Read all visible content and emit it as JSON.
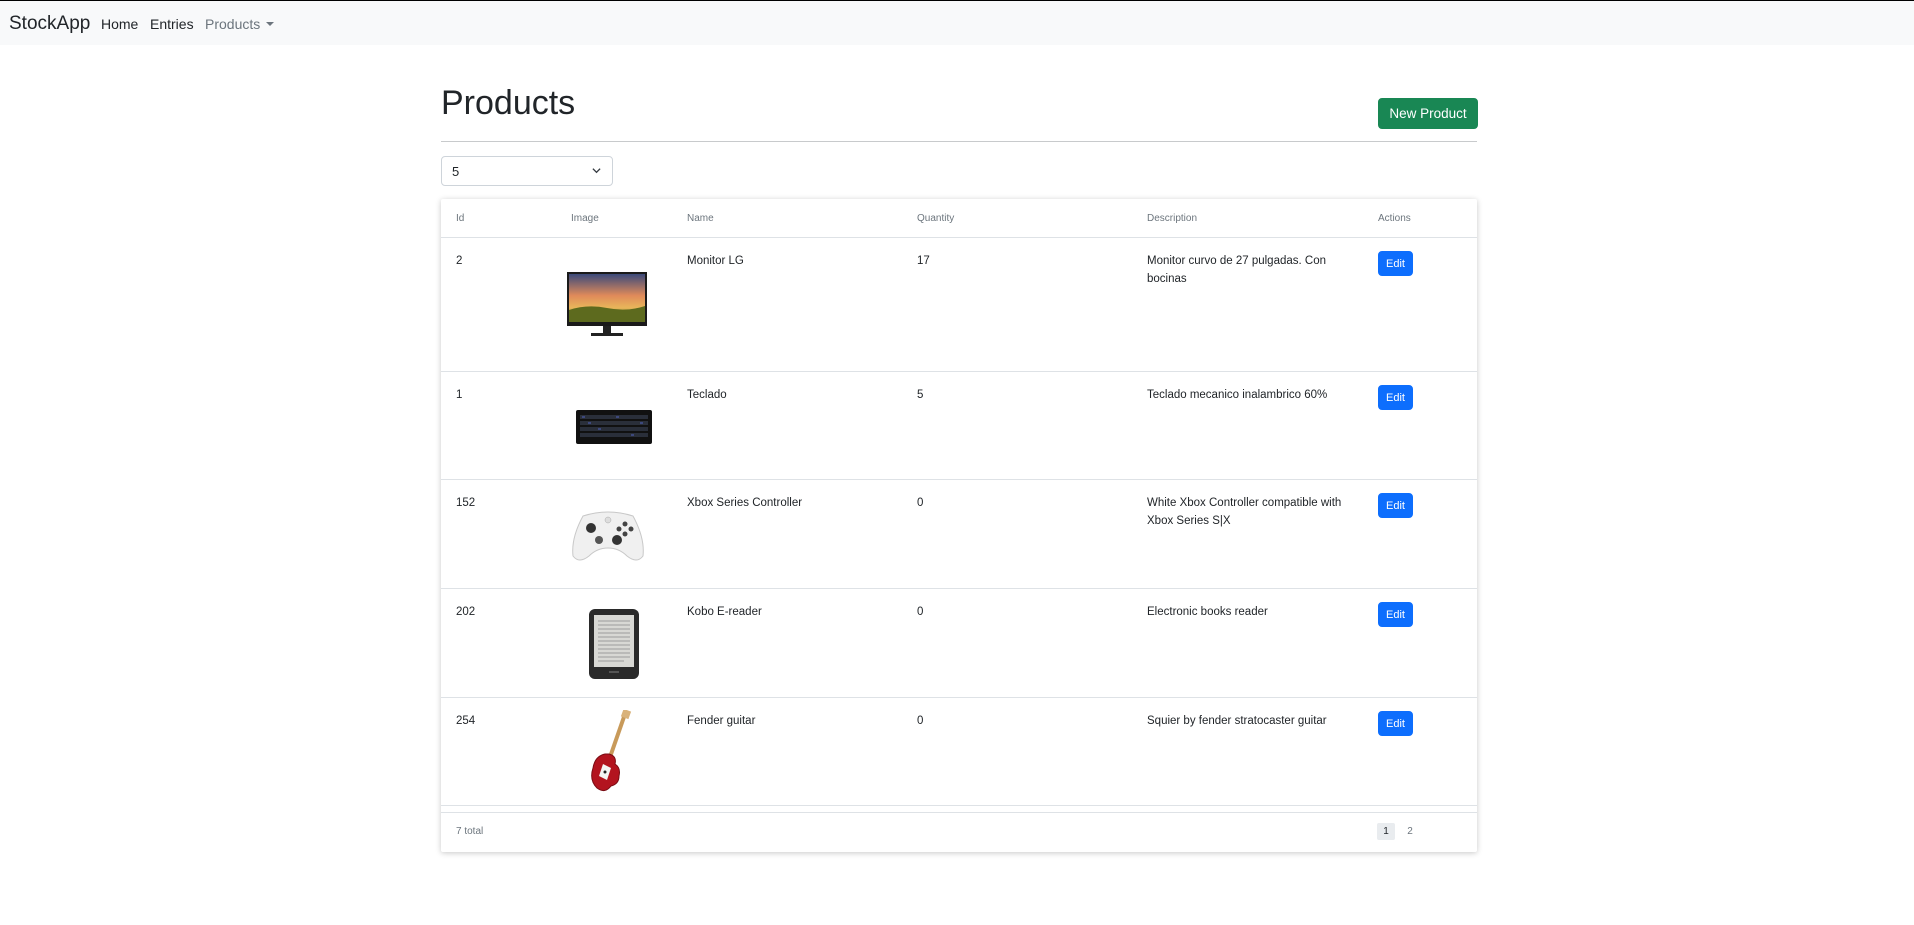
{
  "navbar": {
    "brand": "StockApp",
    "links": [
      {
        "label": "Home"
      },
      {
        "label": "Entries"
      },
      {
        "label": "Products"
      }
    ]
  },
  "page": {
    "title": "Products",
    "new_button": "New Product",
    "page_size": "5"
  },
  "table": {
    "headers": [
      "Id",
      "Image",
      "Name",
      "Quantity",
      "Description",
      "Actions"
    ],
    "rows": [
      {
        "id": "2",
        "image": "monitor",
        "name": "Monitor LG",
        "quantity": "17",
        "description": "Monitor curvo de 27 pulgadas. Con bocinas",
        "action": "Edit"
      },
      {
        "id": "1",
        "image": "keyboard",
        "name": "Teclado",
        "quantity": "5",
        "description": "Teclado mecanico inalambrico 60%",
        "action": "Edit"
      },
      {
        "id": "152",
        "image": "controller",
        "name": "Xbox Series Controller",
        "quantity": "0",
        "description": "White Xbox Controller compatible with Xbox Series S|X",
        "action": "Edit"
      },
      {
        "id": "202",
        "image": "ereader",
        "name": "Kobo E-reader",
        "quantity": "0",
        "description": "Electronic books reader",
        "action": "Edit"
      },
      {
        "id": "254",
        "image": "guitar",
        "name": "Fender guitar",
        "quantity": "0",
        "description": "Squier by fender stratocaster guitar",
        "action": "Edit"
      }
    ]
  },
  "pagination": {
    "total": "7 total",
    "pages": [
      "1",
      "2"
    ],
    "current": "1"
  },
  "colors": {
    "success": "#198754",
    "primary": "#0d6efd",
    "navbar_bg": "#f8f9fa"
  }
}
